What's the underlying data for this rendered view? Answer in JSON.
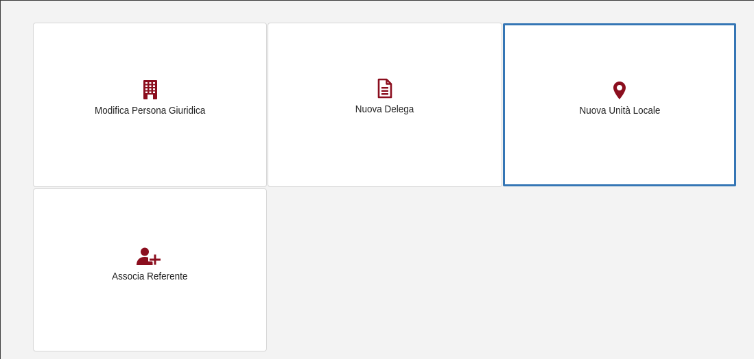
{
  "colors": {
    "accent": "#8b0e1e",
    "selected_border": "#3576b5",
    "background": "#f3f3f3",
    "tile_background": "#ffffff"
  },
  "tiles": [
    {
      "label": "Modifica Persona Giuridica",
      "icon": "building-icon",
      "selected": false
    },
    {
      "label": "Nuova Delega",
      "icon": "document-icon",
      "selected": false
    },
    {
      "label": "Nuova Unità Locale",
      "icon": "map-marker-icon",
      "selected": true
    },
    {
      "label": "Associa Referente",
      "icon": "user-plus-icon",
      "selected": false
    }
  ]
}
